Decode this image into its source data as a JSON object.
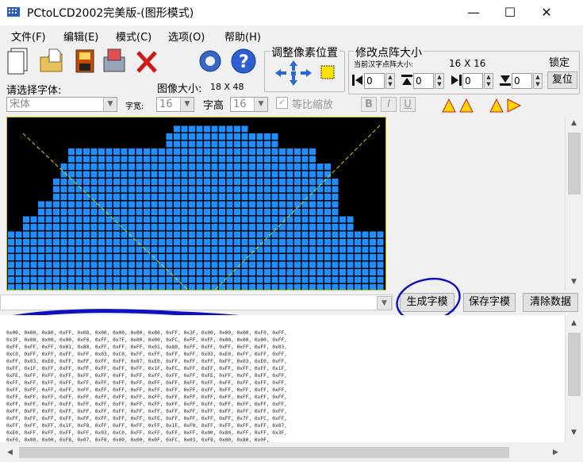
{
  "window": {
    "title": "PCtoLCD2002完美版-(图形模式)",
    "minimize": "—",
    "maximize": "☐",
    "close": "✕"
  },
  "menu": [
    "文件(F)",
    "编辑(E)",
    "模式(C)",
    "选项(O)",
    "帮助(H)"
  ],
  "toolbar": {
    "icons": [
      "new-file-icon",
      "open-folder-icon",
      "save-icon",
      "export-icon",
      "delete-icon",
      "settings-gear-icon",
      "help-icon"
    ]
  },
  "font_panel": {
    "select_font_label": "请选择字体:",
    "font_value": "宋体",
    "char_width_label": "字宽:",
    "char_width_value": "16",
    "char_height_label": "字高",
    "char_height_value": "16",
    "proportional_label": "等比缩放",
    "bold": "B",
    "italic": "I",
    "underline": "U"
  },
  "image_size": {
    "label": "图像大小:",
    "value": "18 X 48"
  },
  "adjust_pixel": {
    "title": "调整像素位置"
  },
  "dot_matrix": {
    "title": "修改点阵大小",
    "current_label": "当前汉字点阵大小:",
    "current_value": "16 X 16",
    "lock_button": "锁定",
    "restore_button": "复位",
    "spinners": [
      "0",
      "0",
      "0",
      "0"
    ]
  },
  "canvas": {
    "background": "#000000",
    "pixel_color": "#1e90ff",
    "guide_color": "#d7d700"
  },
  "actions": {
    "generate": "生成字模",
    "save": "保存字模",
    "clear": "清除数据"
  },
  "output": {
    "lines": [
      "0x00, 0x00, 0x80, 0xFF, 0x08, 0x00, 0x00, 0x00, 0x80, 0xFF, 0x3F, 0x00, 0x00, 0x00, 0xF0, 0xFF,",
      "0x3F, 0x00, 0x00, 0x00, 0xF0, 0xFF, 0x7F, 0x00, 0x00, 0xFC, 0xFF, 0xFF, 0x00, 0x00, 0x00, 0xFF,",
      "0xFF, 0xFF, 0xFF, 0x01, 0x80, 0xFF, 0xFF, 0xFF, 0x01, 0x80, 0xFF, 0xFF, 0xFF, 0xFF, 0xFF, 0x03,",
      "0xC0, 0xFF, 0xFF, 0xFF, 0xFF, 0x03, 0xC0, 0xFF, 0xFF, 0xFF, 0xFF, 0x03, 0xE0, 0xFF, 0xFF, 0xFF,",
      "0xFF, 0x03, 0xE0, 0xFF, 0xFF, 0xFF, 0xFF, 0x07, 0xE0, 0xFF, 0xFF, 0xFF, 0xFF, 0x03, 0xE0, 0xFF,",
      "0xFF, 0x1F, 0xFF, 0xFF, 0xFF, 0xFF, 0xFF, 0xFF, 0x1F, 0xFC, 0xFF, 0xFF, 0xFF, 0xFF, 0xFF, 0x1F,",
      "0xFE, 0xFF, 0xFF, 0xFF, 0xFF, 0xFF, 0xFF, 0xFF, 0xFF, 0xFF, 0xFF, 0xFE, 0xFF, 0xFF, 0xFF, 0xFF,",
      "0xFF, 0xFF, 0xFF, 0xFF, 0xFF, 0xFF, 0xFF, 0xFF, 0xFF, 0xFF, 0xFF, 0xFF, 0xFF, 0xFF, 0xFF, 0xFF,",
      "0xFF, 0xFF, 0xFF, 0xFF, 0xFF, 0xFF, 0xFF, 0xFF, 0xFF, 0xFF, 0xFF, 0xFF, 0xFF, 0xFF, 0xFF, 0xFF,",
      "0xFF, 0xFF, 0xFF, 0xFF, 0xFF, 0xFF, 0xFF, 0xFF, 0xFF, 0xFF, 0xFF, 0xFF, 0xFF, 0xFF, 0xFF, 0xFF,",
      "0xFF, 0xFF, 0xFF, 0xFF, 0xFF, 0xFF, 0xFF, 0xFF, 0xFF, 0xFF, 0xFF, 0xFF, 0xFF, 0xFF, 0xFF, 0xFF,",
      "0xFF, 0xFF, 0xFF, 0xFF, 0xFF, 0xFF, 0xFF, 0xFF, 0xFF, 0xFF, 0xFF, 0xFF, 0xFF, 0xFF, 0xFF, 0xFF,",
      "0xFF, 0xFF, 0xFF, 0xFF, 0xFF, 0xFF, 0xFF, 0xFF, 0xFE, 0xFF, 0xFF, 0xFF, 0xFF, 0x7F, 0xFC, 0xFF,",
      "0xFF, 0xFF, 0xFF, 0x1F, 0xF8, 0xFF, 0xFF, 0xFF, 0xFF, 0x1F, 0xF0, 0xFF, 0xFF, 0xFF, 0xFF, 0x07,",
      "0xE0, 0xFF, 0xFF, 0xFF, 0xFF, 0x03, 0xC0, 0xFF, 0xFF, 0xFF, 0xFF, 0x00, 0x80, 0xFF, 0xFF, 0x3F,",
      "0xF0, 0x00, 0x00, 0xF8, 0x07, 0xF0, 0x00, 0x00, 0x0F, 0xFC, 0x03, 0xF8, 0x00, 0x80, 0x0F,"
    ]
  }
}
